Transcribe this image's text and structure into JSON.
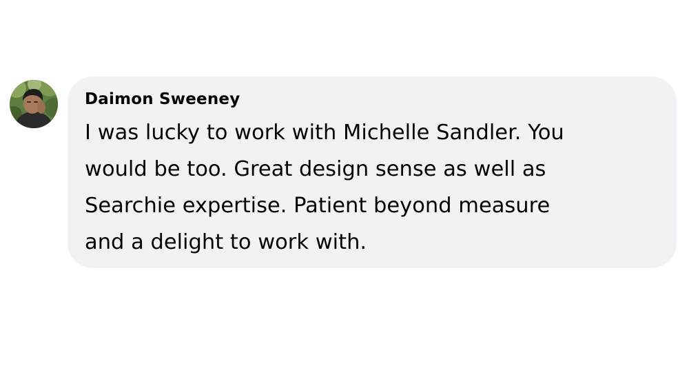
{
  "comment": {
    "author": "Daimon Sweeney",
    "lines": [
      "I was lucky to work with Michelle Sandler. You",
      "would be too. Great design sense as well as",
      "Searchie expertise. Patient beyond measure",
      "and a delight to work with."
    ]
  },
  "colors": {
    "bubble_background": "#f0f2f5",
    "text": "#050505",
    "page_background": "#ffffff"
  }
}
